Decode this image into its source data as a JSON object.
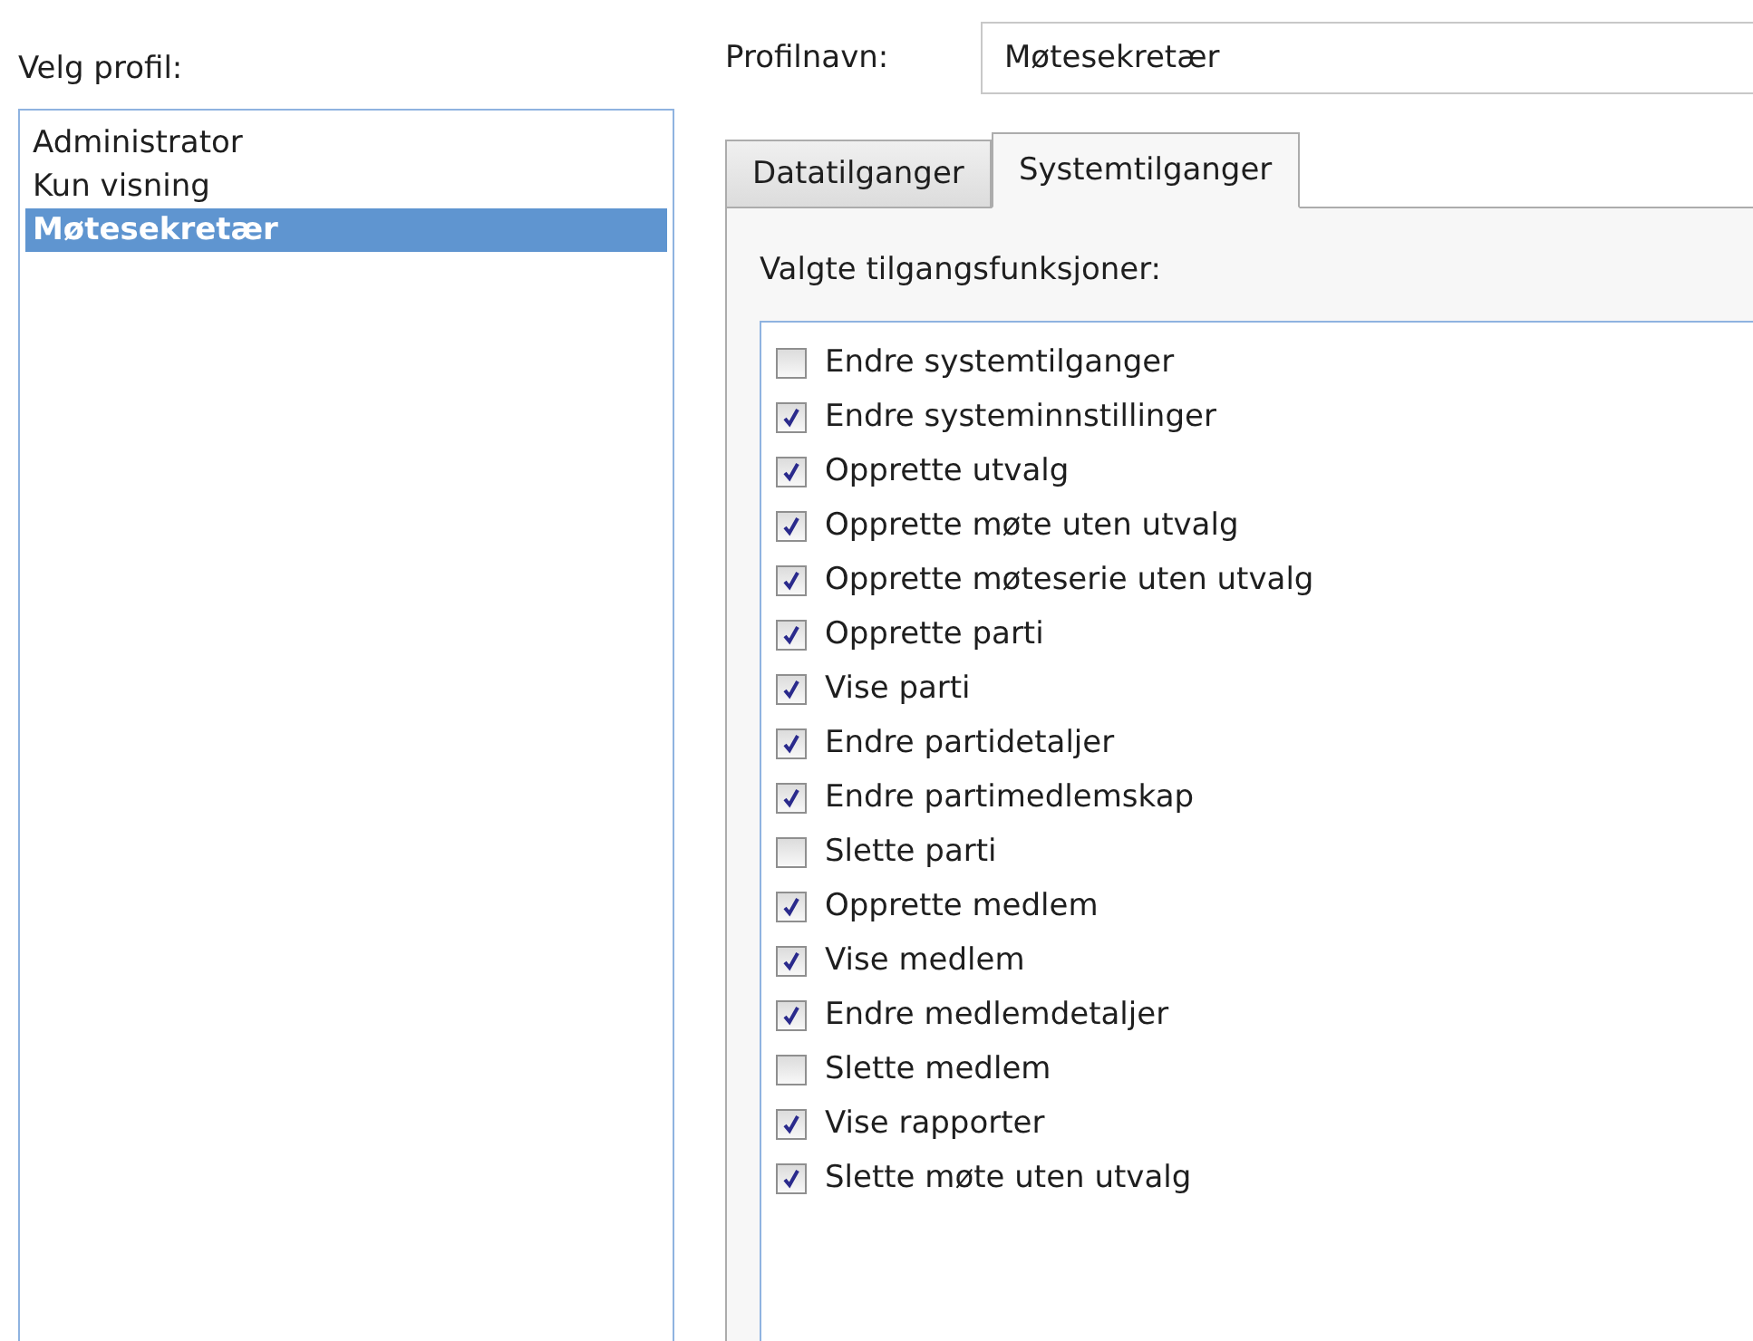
{
  "profile_picker": {
    "label": "Velg profil:",
    "items": [
      {
        "name": "Administrator",
        "selected": false
      },
      {
        "name": "Kun visning",
        "selected": false
      },
      {
        "name": "Møtesekretær",
        "selected": true
      }
    ]
  },
  "profile_name": {
    "label": "Profilnavn:",
    "value": "Møtesekretær"
  },
  "tabs": [
    {
      "label": "Datatilganger",
      "selected": false
    },
    {
      "label": "Systemtilganger",
      "selected": true
    }
  ],
  "permissions": {
    "label": "Valgte tilgangsfunksjoner:",
    "items": [
      {
        "label": "Endre systemtilganger",
        "checked": false
      },
      {
        "label": "Endre systeminnstillinger",
        "checked": true
      },
      {
        "label": "Opprette utvalg",
        "checked": true
      },
      {
        "label": "Opprette møte uten utvalg",
        "checked": true
      },
      {
        "label": "Opprette møteserie uten utvalg",
        "checked": true
      },
      {
        "label": "Opprette parti",
        "checked": true
      },
      {
        "label": "Vise parti",
        "checked": true
      },
      {
        "label": "Endre partidetaljer",
        "checked": true
      },
      {
        "label": "Endre partimedlemskap",
        "checked": true
      },
      {
        "label": "Slette parti",
        "checked": false
      },
      {
        "label": "Opprette medlem",
        "checked": true
      },
      {
        "label": "Vise medlem",
        "checked": true
      },
      {
        "label": "Endre medlemdetaljer",
        "checked": true
      },
      {
        "label": "Slette medlem",
        "checked": false
      },
      {
        "label": "Vise rapporter",
        "checked": true
      },
      {
        "label": "Slette møte uten utvalg",
        "checked": true
      }
    ]
  }
}
